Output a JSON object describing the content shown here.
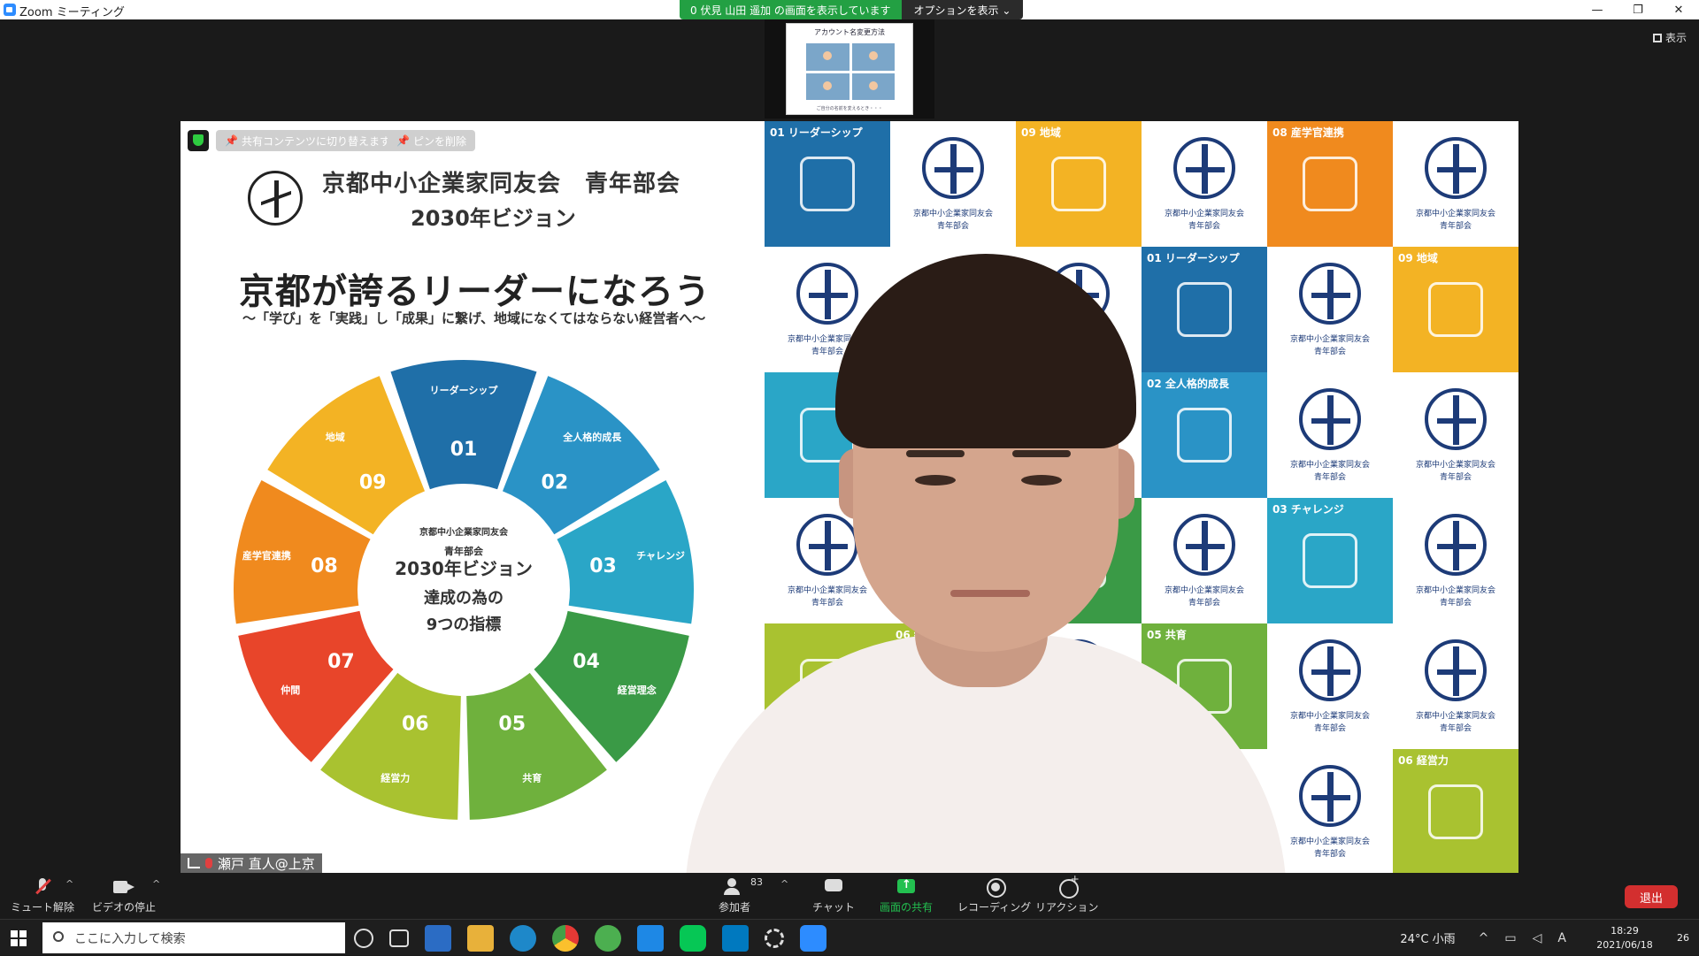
{
  "window": {
    "title": "Zoom ミーティング",
    "controls": [
      "—",
      "❐",
      "✕"
    ]
  },
  "share_banner": {
    "viewing": "0 伏見 山田 遥加 の画面を表示しています",
    "options": "オプションを表示 ⌄"
  },
  "view_button": "表示",
  "thumbnail": {
    "title": "アカウント名変更方法",
    "footer": "ご自分の名前を変えるとき・・・"
  },
  "stage_buttons": {
    "switch_content": "共有コンテンツに切り替えます",
    "unpin": "ピンを削除"
  },
  "slide": {
    "org": "京都中小企業家同友会　青年部会",
    "vision": "2030年ビジョン",
    "headline": "京都が誇るリーダーになろう",
    "subtitle": "〜「学び」を「実践」し「成果」に繋げ、地域になくてはならない経営者へ〜",
    "wheel_center": [
      "京都中小企業家同友会",
      "青年部会",
      "2030年ビジョン",
      "達成の為の",
      "9つの指標"
    ],
    "segments": [
      {
        "num": "01",
        "label": "リーダーシップ",
        "color": "#1f6fa8"
      },
      {
        "num": "02",
        "label": "全人格的成長",
        "color": "#2a93c6"
      },
      {
        "num": "03",
        "label": "チャレンジ",
        "color": "#2aa6c7"
      },
      {
        "num": "04",
        "label": "経営理念",
        "color": "#3a9a46"
      },
      {
        "num": "05",
        "label": "共育",
        "color": "#6fb13d"
      },
      {
        "num": "06",
        "label": "経営力",
        "color": "#a9c230"
      },
      {
        "num": "07",
        "label": "仲間",
        "color": "#e8452a"
      },
      {
        "num": "08",
        "label": "産学官連携",
        "color": "#f08a1e"
      },
      {
        "num": "09",
        "label": "地域",
        "color": "#f3b324"
      }
    ]
  },
  "tiles": [
    {
      "label": "01 リーダーシップ",
      "color": "#1f6fa8",
      "logo": false
    },
    {
      "label": "",
      "color": "#ffffff",
      "logo": true
    },
    {
      "label": "09 地域",
      "color": "#f3b324",
      "logo": false
    },
    {
      "label": "",
      "color": "#ffffff",
      "logo": true
    },
    {
      "label": "08 産学官連携",
      "color": "#f08a1e",
      "logo": false
    },
    {
      "label": "",
      "color": "#ffffff",
      "logo": true
    },
    {
      "label": "",
      "color": "#ffffff",
      "logo": true
    },
    {
      "label": "",
      "color": "#ffffff",
      "logo": true
    },
    {
      "label": "",
      "color": "#ffffff",
      "logo": true
    },
    {
      "label": "01 リーダーシップ",
      "color": "#1f6fa8",
      "logo": false
    },
    {
      "label": "",
      "color": "#ffffff",
      "logo": true
    },
    {
      "label": "09 地域",
      "color": "#f3b324",
      "logo": false
    },
    {
      "label": "",
      "color": "#2aa6c7",
      "logo": false
    },
    {
      "label": "",
      "color": "#2aa6c7",
      "logo": false
    },
    {
      "label": "",
      "color": "#ffffff",
      "logo": true
    },
    {
      "label": "02 全人格的成長",
      "color": "#2a93c6",
      "logo": false
    },
    {
      "label": "",
      "color": "#ffffff",
      "logo": true
    },
    {
      "label": "",
      "color": "#ffffff",
      "logo": true
    },
    {
      "label": "",
      "color": "#ffffff",
      "logo": true
    },
    {
      "label": "",
      "color": "#ffffff",
      "logo": true
    },
    {
      "label": "04 経営理念",
      "color": "#3a9a46",
      "logo": false
    },
    {
      "label": "",
      "color": "#ffffff",
      "logo": true
    },
    {
      "label": "03 チャレンジ",
      "color": "#2aa6c7",
      "logo": false
    },
    {
      "label": "",
      "color": "#ffffff",
      "logo": true
    },
    {
      "label": "",
      "color": "#a9c230",
      "logo": false
    },
    {
      "label": "06 経営力",
      "color": "#a9c230",
      "logo": false
    },
    {
      "label": "",
      "color": "#ffffff",
      "logo": true
    },
    {
      "label": "05 共育",
      "color": "#6fb13d",
      "logo": false
    },
    {
      "label": "",
      "color": "#ffffff",
      "logo": true
    },
    {
      "label": "",
      "color": "#ffffff",
      "logo": true
    },
    {
      "label": "",
      "color": "#e8452a",
      "logo": false
    },
    {
      "label": "",
      "color": "#e8452a",
      "logo": false
    },
    {
      "label": "",
      "color": "#ffffff",
      "logo": true
    },
    {
      "label": "",
      "color": "#ffffff",
      "logo": true
    },
    {
      "label": "",
      "color": "#ffffff",
      "logo": true
    },
    {
      "label": "06 経営力",
      "color": "#a9c230",
      "logo": false
    }
  ],
  "logo_caption": [
    "京都中小企業家同友会",
    "青年部会"
  ],
  "speaker_name": "瀬戸 直人@上京",
  "toolbar": {
    "mute": "ミュート解除",
    "video": "ビデオの停止",
    "participants": "参加者",
    "participant_count": "83",
    "chat": "チャット",
    "share": "画面の共有",
    "record": "レコーディング",
    "reactions": "リアクション",
    "leave": "退出"
  },
  "taskbar": {
    "search_placeholder": "ここに入力して検索",
    "weather": "24°C 小雨",
    "time": "18:29",
    "date": "2021/06/18",
    "ime": "A",
    "notification_count": "26"
  }
}
